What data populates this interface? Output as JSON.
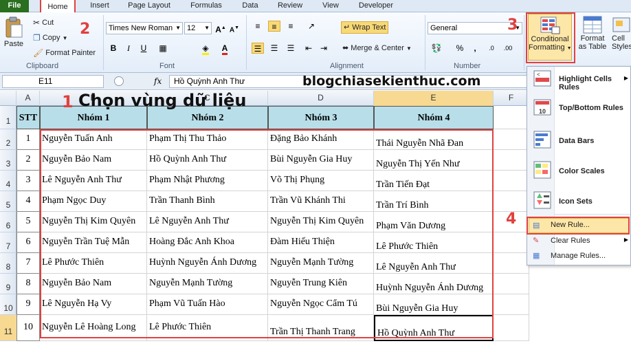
{
  "ribbon_tabs": [
    "File",
    "Home",
    "Insert",
    "Page Layout",
    "Formulas",
    "Data",
    "Review",
    "View",
    "Developer"
  ],
  "clipboard": {
    "paste": "Paste",
    "cut": "Cut",
    "copy": "Copy",
    "format_painter": "Format Painter",
    "label": "Clipboard"
  },
  "font": {
    "name": "Times New Roman",
    "size": "12",
    "bold": "B",
    "italic": "I",
    "underline": "U",
    "label": "Font"
  },
  "alignment": {
    "wrap_text": "Wrap Text",
    "merge_center": "Merge & Center",
    "label": "Alignment"
  },
  "number": {
    "format": "General",
    "percent": "%",
    "comma": ",",
    "label": "Number"
  },
  "styles": {
    "conditional_formatting": [
      "Conditional",
      "Formatting"
    ],
    "format_as_table": [
      "Format",
      "as Table"
    ],
    "cell_styles": [
      "Cell",
      "Styles"
    ]
  },
  "formula_bar": {
    "name_box": "E11",
    "fx": "fx",
    "value": "Hồ Quỳnh Anh Thư"
  },
  "watermark": "blogchiasekienthuc.com",
  "annotations": {
    "n1": "1",
    "n1_text": "Chọn vùng dữ liệu",
    "n2": "2",
    "n3": "3",
    "n4": "4"
  },
  "columns": [
    "A",
    "B",
    "C",
    "D",
    "E",
    "F"
  ],
  "rows": [
    "1",
    "2",
    "3",
    "4",
    "5",
    "6",
    "7",
    "8",
    "9",
    "10",
    "11"
  ],
  "table": {
    "headers": [
      "STT",
      "Nhóm 1",
      "Nhóm 2",
      "Nhóm 3",
      "Nhóm 4"
    ],
    "stt": [
      "1",
      "2",
      "3",
      "4",
      "5",
      "6",
      "7",
      "8",
      "9",
      "10"
    ],
    "nhom1": [
      "Nguyễn Tuấn Anh",
      "Nguyễn Bảo Nam",
      "Lê Nguyễn Anh Thư",
      "Phạm Ngọc Duy",
      "Nguyễn Thị Kim Quyên",
      "Nguyễn Trần Tuệ Mẫn",
      "Lê Phước Thiên",
      "Nguyễn Bảo Nam",
      "Lê Nguyễn Hạ Vy",
      "Nguyễn Lê Hoàng Long"
    ],
    "nhom2": [
      "Phạm Thị Thu Thảo",
      "Hồ Quỳnh Anh Thư",
      "Phạm Nhật Phương",
      "Trần Thanh Bình",
      "Lê Nguyễn Anh Thư",
      "Hoàng Đắc Anh Khoa",
      "Huỳnh Nguyễn Ánh Dương",
      "Nguyễn Mạnh Tường",
      "Phạm Vũ Tuấn Hào",
      "Lê Phước Thiên"
    ],
    "nhom3": [
      "Đặng Bảo Khánh",
      "Bùi Nguyễn Gia Huy",
      "Võ Thị Phụng",
      "Trần Vũ Khánh Thi",
      "Nguyễn Thị Kim Quyên",
      "Đàm Hiếu Thiện",
      "Nguyễn Mạnh Tường",
      "Nguyễn Trung Kiên",
      "Nguyễn Ngọc Cẩm Tú",
      "Trần Thị Thanh Trang"
    ],
    "nhom4": [
      "Thái Nguyễn Nhã Đan",
      "Nguyễn Thị Yến Như",
      "Trần Tiến Đạt",
      "Trần Trí Bình",
      "Phạm Văn Dương",
      "Lê Phước Thiên",
      "Lê Nguyễn Anh Thư",
      "Huỳnh Nguyễn Ánh Dương",
      "Bùi Nguyễn Gia Huy",
      "Hồ Quỳnh Anh Thư"
    ]
  },
  "cf_menu": {
    "items": [
      "Highlight Cells Rules",
      "Top/Bottom Rules",
      "Data Bars",
      "Color Scales",
      "Icon Sets"
    ],
    "new_rule": "New Rule...",
    "clear_rules": "Clear Rules",
    "manage_rules": "Manage Rules..."
  },
  "colors": {
    "accent_red": "#e0413f",
    "header_fill": "#b8dfe9",
    "file_tab": "#2a6e1f",
    "selection": "#f7d991"
  }
}
